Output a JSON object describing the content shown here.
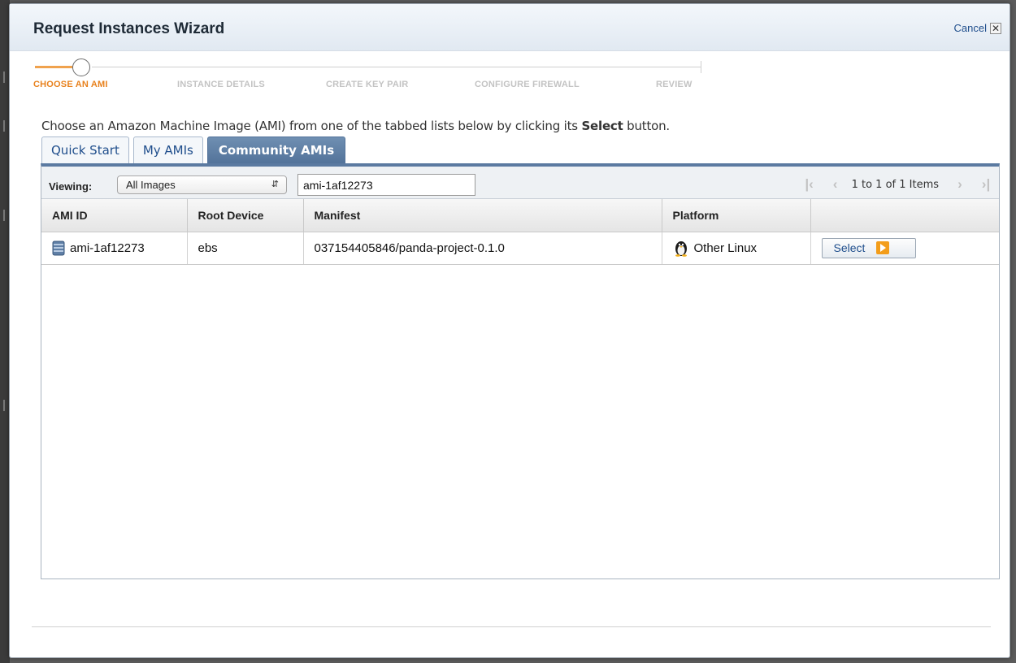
{
  "dialog": {
    "title": "Request Instances Wizard",
    "cancel_label": "Cancel",
    "close_glyph": "✕"
  },
  "steps": [
    {
      "label": "CHOOSE AN AMI",
      "active": true
    },
    {
      "label": "INSTANCE DETAILS",
      "active": false
    },
    {
      "label": "CREATE KEY PAIR",
      "active": false
    },
    {
      "label": "CONFIGURE FIREWALL",
      "active": false
    },
    {
      "label": "REVIEW",
      "active": false
    }
  ],
  "intro": {
    "before": "Choose an Amazon Machine Image (AMI) from one of the tabbed lists below by clicking its ",
    "bold": "Select",
    "after": " button."
  },
  "tabs": [
    {
      "label": "Quick Start",
      "active": false
    },
    {
      "label": "My AMIs",
      "active": false
    },
    {
      "label": "Community AMIs",
      "active": true
    }
  ],
  "toolbar": {
    "viewing_label": "Viewing:",
    "viewing_value": "All Images",
    "search_value": "ami-1af12273",
    "pager_text": "1 to 1 of 1 Items"
  },
  "table": {
    "columns": [
      "AMI ID",
      "Root Device",
      "Manifest",
      "Platform",
      ""
    ],
    "rows": [
      {
        "ami_id": "ami-1af12273",
        "root_device": "ebs",
        "manifest": "037154405846/panda-project-0.1.0",
        "platform": "Other Linux",
        "action": "Select"
      }
    ]
  },
  "icons": {
    "ami": "ami-disk-icon",
    "platform": "linux-penguin-icon",
    "action": "play-arrow-icon"
  },
  "colors": {
    "active_step": "#e8821e",
    "active_tab": "#5b7aa1",
    "link": "#1f4e8c",
    "action_icon": "#f39d1a"
  }
}
